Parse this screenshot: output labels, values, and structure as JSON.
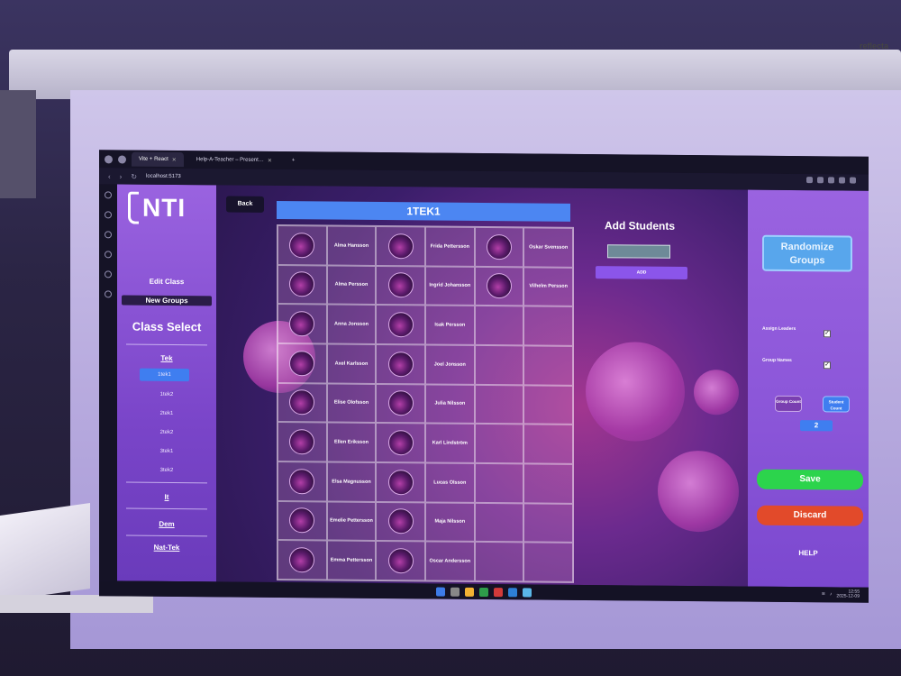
{
  "room": {
    "projector_brand": "reflecta"
  },
  "browser": {
    "tabs": [
      {
        "label": "Vite + React",
        "active": true
      },
      {
        "label": "Help-A-Teacher – Present…",
        "active": false
      }
    ],
    "new_tab": "+",
    "url": "localhost:5173"
  },
  "sidebar": {
    "logo_text": "NTI",
    "edit_class": "Edit Class",
    "new_groups": "New Groups",
    "class_select_title": "Class Select",
    "groups": [
      {
        "title": "Tek",
        "classes": [
          "1tek1",
          "1tek2",
          "2tek1",
          "2tek2",
          "3tek1",
          "3tek2"
        ],
        "selected": "1tek1"
      },
      {
        "title": "It"
      },
      {
        "title": "Dem"
      },
      {
        "title": "Nat-Tek"
      }
    ]
  },
  "main": {
    "back_label": "Back",
    "class_title": "1TEK1",
    "students": [
      "Alma Hansson",
      "Frida Pettersson",
      "Oskar Svensson",
      "Alma Persson",
      "Ingrid Johansson",
      "Vilhelm Persson",
      "Anna Jonsson",
      "Isak Persson",
      "",
      "Axel Karlsson",
      "Joel Jonsson",
      "",
      "Elise Olofsson",
      "Julia Nilsson",
      "",
      "Ellen Eriksson",
      "Karl Lindström",
      "",
      "Elsa Magnusson",
      "Lucas Olsson",
      "",
      "Emelie Pettersson",
      "Maja Nilsson",
      "",
      "Emma Pettersson",
      "Oscar Andersson",
      ""
    ]
  },
  "add_students": {
    "title": "Add Students",
    "input_value": "",
    "add_label": "ADD"
  },
  "right_panel": {
    "randomize_label": "Randomize Groups",
    "assign_leaders_label": "Assign Leaders",
    "assign_leaders_checked": true,
    "group_names_label": "Group Names",
    "group_names_checked": true,
    "group_count_label": "Group Count",
    "student_count_label": "Student Count",
    "count_value": "2",
    "save_label": "Save",
    "discard_label": "Discard",
    "help_label": "HELP"
  },
  "taskbar": {
    "time": "12:55",
    "date": "2025-12-09"
  },
  "colors": {
    "accent_blue": "#4c86f2",
    "sidebar_purple": "#9a63e0",
    "save_green": "#2cd44c",
    "discard_red": "#e24a2a"
  }
}
